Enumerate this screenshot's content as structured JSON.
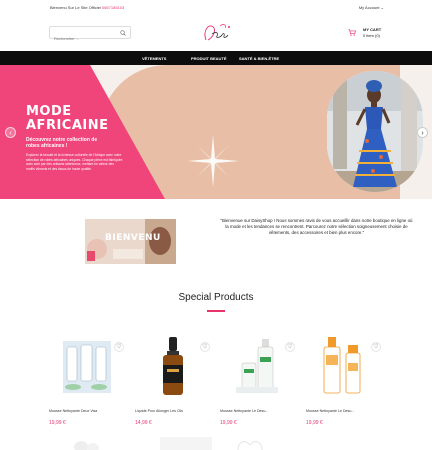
{
  "topbar": {
    "welcome": "Bienvenu Sur Le Site Officiel",
    "phone": "0657185103",
    "account": "My Account",
    "account_chevron": "⌄"
  },
  "search": {
    "placeholder": "Rechercher ...",
    "icon": "search-icon"
  },
  "logo": {
    "alt_text": "DaisyShop"
  },
  "cart": {
    "title": "MY CART",
    "count": "0 item (0)",
    "icon": "cart-icon"
  },
  "nav": {
    "items": [
      {
        "label": "VÊTEMENTS"
      },
      {
        "label": "PRODUIT BEAUTÉ"
      },
      {
        "label": "SANTÉ & BIEN-ÊTRE"
      }
    ]
  },
  "hero": {
    "title": "MODE AFRICAINE",
    "subtitle": "Découvrez notre collection de robes africaines !",
    "description": "Explorez la beauté et la richesse culturelle de l'Afrique avec notre sélection de robes africaines uniques. Chaque pièce est fabriquée avec soin par des artisans talentueux, mettant en valeur des motifs vibrants et des tissus de haute qualité.",
    "prev_arrow": "‹",
    "next_arrow": "›",
    "colors": {
      "pink": "#f0457a",
      "peach": "#e8bfa6",
      "background": "#f6f0ec"
    }
  },
  "welcome_section": {
    "banner_label": "BIENVENU",
    "text": "\"Bienvenue sur DaisyShop ! Nous sommes ravis de vous accueillir dans notre boutique en ligne où la mode et les tendances se rencontrent. Parcourez notre sélection soigneusement choisie de vêtements, des accessoires et bien plus encore.\""
  },
  "special_products": {
    "title": "Special Products",
    "accent_color": "#e8336d",
    "items": [
      {
        "name": "Mousse Nettoyante Deux Visa",
        "price": "19,99 €",
        "wishlist_icon": "heart-icon"
      },
      {
        "name": "Liquide Pour Allonger Les Cils",
        "price": "14,99 €",
        "wishlist_icon": "heart-icon"
      },
      {
        "name": "Mousse Nettoyante Le Desu...",
        "price": "19,99 €",
        "wishlist_icon": "heart-icon"
      },
      {
        "name": "Mousse Nettoyante Le Desu...",
        "price": "19,99 €",
        "wishlist_icon": "heart-icon"
      }
    ]
  }
}
